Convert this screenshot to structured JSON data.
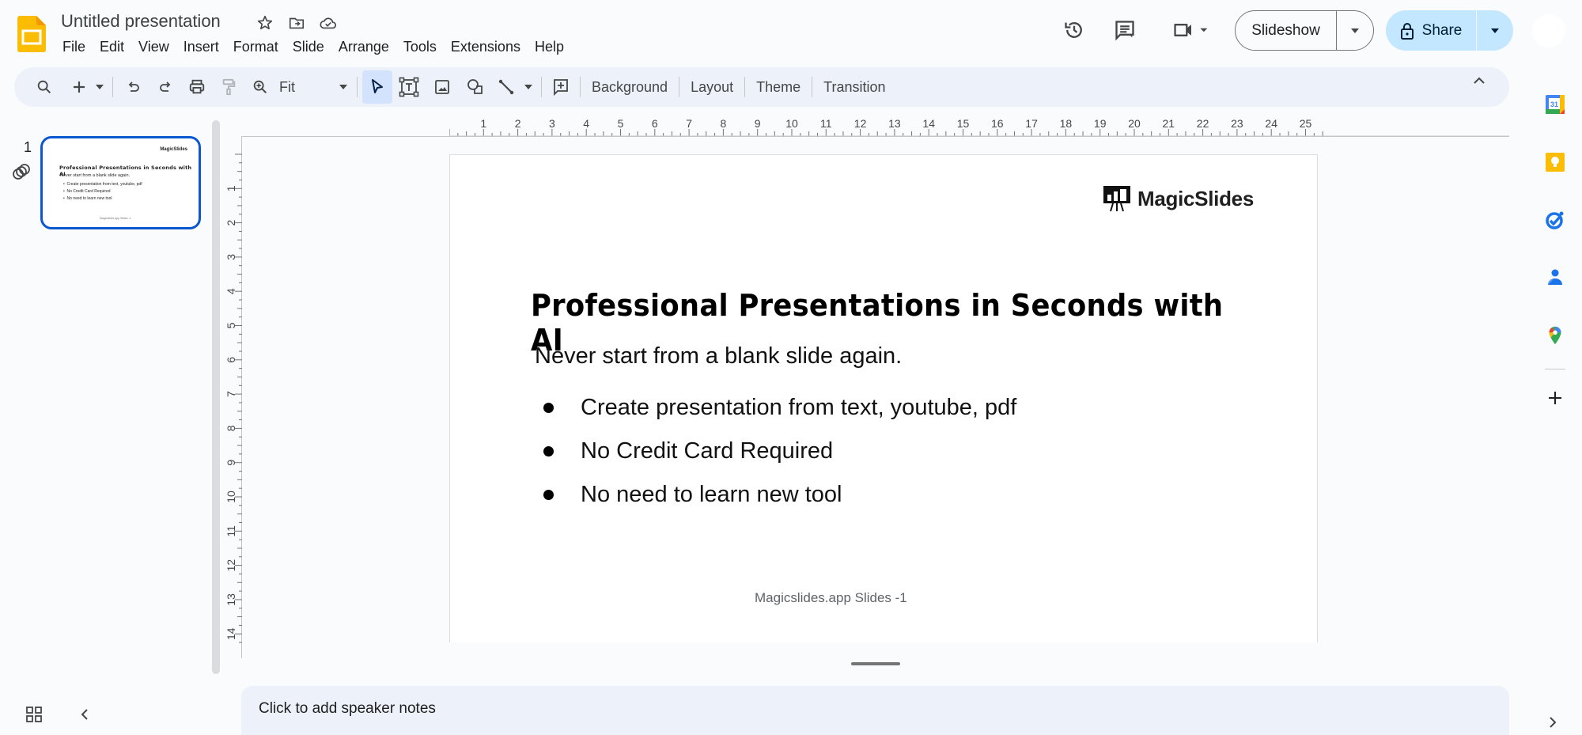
{
  "app": {
    "document_title": "Untitled presentation",
    "title_icons": [
      "star-icon",
      "move-to-folder-icon",
      "cloud-saved-icon"
    ]
  },
  "menubar": [
    "File",
    "Edit",
    "View",
    "Insert",
    "Format",
    "Slide",
    "Arrange",
    "Tools",
    "Extensions",
    "Help"
  ],
  "header": {
    "slideshow_label": "Slideshow",
    "share_label": "Share",
    "icons": [
      "version-history-icon",
      "comments-icon",
      "meet-icon"
    ]
  },
  "toolbar": {
    "zoom_value": "Fit",
    "background_label": "Background",
    "layout_label": "Layout",
    "theme_label": "Theme",
    "transition_label": "Transition"
  },
  "filmstrip": {
    "slides": [
      {
        "number": "1",
        "selected": true,
        "logo": "MagicSlides",
        "title": "Professional Presentations in Seconds with AI",
        "subtitle": "Never start from a blank slide again.",
        "bullets": [
          "Create presentation from text, youtube, pdf",
          "No Credit Card Required",
          "No need to learn new tool"
        ],
        "footer": "Magicslides.app Slides -1"
      }
    ]
  },
  "rulers": {
    "horizontal_ticks": [
      "1",
      "2",
      "3",
      "4",
      "5",
      "6",
      "7",
      "8",
      "9",
      "10",
      "11",
      "12",
      "13",
      "14",
      "15",
      "16",
      "17",
      "18",
      "19",
      "20",
      "21",
      "22",
      "23",
      "24",
      "25"
    ],
    "vertical_ticks": [
      "1",
      "2",
      "3",
      "4",
      "5",
      "6",
      "7",
      "8",
      "9",
      "10",
      "11",
      "12",
      "13",
      "14"
    ]
  },
  "slide": {
    "logo_text": "MagicSlides",
    "title": "Professional Presentations in Seconds with AI",
    "subtitle": "Never start from a blank slide again.",
    "bullets": [
      "Create presentation from text, youtube, pdf",
      "No Credit Card Required",
      "No need to learn new tool"
    ],
    "footer": "Magicslides.app Slides -1"
  },
  "notes": {
    "placeholder": "Click to add speaker notes"
  },
  "side_panel": {
    "apps": [
      "calendar-icon",
      "keep-icon",
      "tasks-icon",
      "contacts-icon",
      "maps-icon"
    ],
    "add_label": "+"
  }
}
